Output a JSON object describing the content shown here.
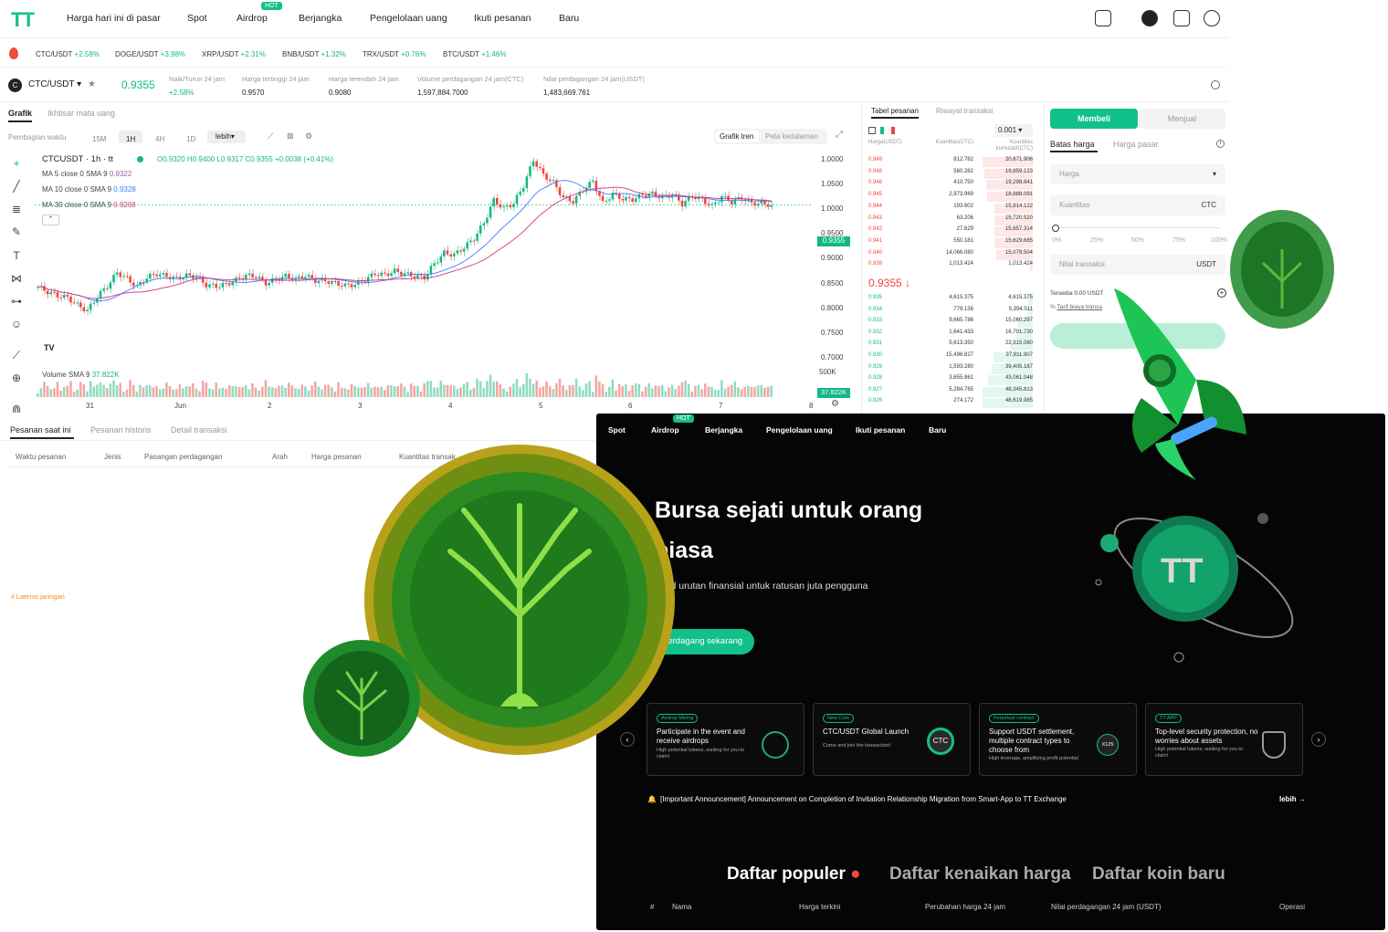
{
  "nav": {
    "logo": "TT",
    "items": [
      "Harga hari ini di pasar",
      "Spot",
      "Airdrop",
      "Berjangka",
      "Pengelolaan uang",
      "Ikuti pesanan",
      "Baru"
    ],
    "hot_badge": "HOT"
  },
  "ticker": [
    {
      "pair": "CTC/USDT",
      "change": "+2.58%"
    },
    {
      "pair": "DOGE/USDT",
      "change": "+3.98%"
    },
    {
      "pair": "XRP/USDT",
      "change": "+2.31%"
    },
    {
      "pair": "BNB/USDT",
      "change": "+1.32%"
    },
    {
      "pair": "TRX/USDT",
      "change": "+0.76%"
    },
    {
      "pair": "BTC/USDT",
      "change": "+1.46%"
    }
  ],
  "pair": {
    "name": "CTC/USDT",
    "price": "0.9355",
    "stats": [
      {
        "label": "Naik/Turun 24 jam",
        "value": "+2.58%"
      },
      {
        "label": "Harga tertinggi 24 jam",
        "value": "0.9570"
      },
      {
        "label": "Harga terendah 24 jam",
        "value": "0.9080"
      },
      {
        "label": "Volume perdagangan 24 jam(CTC)",
        "value": "1,597,884.7000"
      },
      {
        "label": "Nilai perdagangan 24 jam(USDT)",
        "value": "1,483,669.761"
      }
    ]
  },
  "chart_tabs": [
    "Grafik",
    "Ikhtisar mata uang"
  ],
  "timeframes": {
    "label": "Pembagian waktu",
    "items": [
      "15M",
      "1H",
      "4H",
      "1D"
    ],
    "active": "1H",
    "more": "lebih",
    "view_trend": "Grafik tren",
    "view_depth": "Peta kedalaman"
  },
  "chart_legend": {
    "symbol": "CTCUSDT · 1h · tt",
    "ohlc": "O0.9320 H0.9400 L0.9317 C0.9355 +0.0038 (+0.41%)",
    "ma5": "MA 5 close 0 SMA 9",
    "ma5_val": "0.9322",
    "ma10": "MA 10 close 0 SMA 9",
    "ma10_val": "0.9328",
    "ma30": "MA 30 close 0 SMA 9",
    "ma30_val": "0.9268",
    "volume": "Volume SMA 9",
    "volume_val": "37.822K",
    "last_price": "0.9355",
    "last_volume": "37.822K",
    "vol_axis": "500K"
  },
  "chart_data": {
    "type": "candlestick",
    "ylim": [
      0.695,
      1.0
    ],
    "y_ticks": [
      "1.0000",
      "1.0500",
      "1.0000",
      "0.9500",
      "0.9000",
      "0.8500",
      "0.8000",
      "0.7500",
      "0.7000"
    ],
    "x_ticks": [
      "31",
      "Jun",
      "2",
      "3",
      "4",
      "5",
      "6",
      "7",
      "8"
    ],
    "close": [
      0.805,
      0.797,
      0.791,
      0.788,
      0.776,
      0.767,
      0.79,
      0.806,
      0.828,
      0.818,
      0.805,
      0.82,
      0.826,
      0.822,
      0.818,
      0.823,
      0.821,
      0.808,
      0.806,
      0.809,
      0.816,
      0.823,
      0.822,
      0.811,
      0.817,
      0.822,
      0.817,
      0.823,
      0.815,
      0.815,
      0.811,
      0.807,
      0.809,
      0.816,
      0.826,
      0.824,
      0.83,
      0.826,
      0.822,
      0.82,
      0.842,
      0.859,
      0.856,
      0.868,
      0.882,
      0.907,
      0.943,
      0.93,
      0.938,
      0.966,
      1.007,
      0.983,
      0.971,
      0.947,
      0.941,
      0.96,
      0.973,
      0.938,
      0.953,
      0.945,
      0.944,
      0.951,
      0.953,
      0.947,
      0.952,
      0.937,
      0.95,
      0.944,
      0.933,
      0.949,
      0.94,
      0.947,
      0.938,
      0.938,
      0.935
    ]
  },
  "orderbook": {
    "tabs": [
      "Tabel pesanan",
      "Riwayat transaksi"
    ],
    "precision": "0.001",
    "col_price": "Harga(USDT)",
    "col_qty": "Kuantitas(CTC)",
    "col_cum": "Kuantitas kumulatif(CTC)",
    "asks": [
      [
        "0.949",
        "812.782",
        "20,671.906"
      ],
      [
        "0.948",
        "560.282",
        "19,859.123"
      ],
      [
        "0.946",
        "410.750",
        "19,298.841"
      ],
      [
        "0.945",
        "2,973.969",
        "18,888.091"
      ],
      [
        "0.944",
        "193.602",
        "15,914.122"
      ],
      [
        "0.943",
        "63.206",
        "15,720.520"
      ],
      [
        "0.942",
        "27.629",
        "15,657.314"
      ],
      [
        "0.941",
        "550.181",
        "15,629.685"
      ],
      [
        "0.940",
        "14,066.080",
        "15,079.504"
      ],
      [
        "0.939",
        "1,013.424",
        "1,013.424"
      ]
    ],
    "mid_price": "0.9355",
    "bids": [
      [
        "0.935",
        "4,615.375",
        "4,615.375"
      ],
      [
        "0.934",
        "779.136",
        "5,394.511"
      ],
      [
        "0.933",
        "9,665.786",
        "15,060.297"
      ],
      [
        "0.932",
        "1,641.433",
        "16,701.730"
      ],
      [
        "0.931",
        "5,613.350",
        "22,315.080"
      ],
      [
        "0.930",
        "15,496.827",
        "37,811.907"
      ],
      [
        "0.929",
        "1,593.280",
        "39,405.187"
      ],
      [
        "0.928",
        "3,655.861",
        "43,061.048"
      ],
      [
        "0.927",
        "5,284.765",
        "48,345.813"
      ],
      [
        "0.926",
        "274.172",
        "48,619.985"
      ]
    ]
  },
  "trade": {
    "buy": "Membeli",
    "sell": "Menjual",
    "limit": "Batas harga",
    "market": "Harga pasar",
    "price_ph": "Harga",
    "qty_ph": "Kuantitas",
    "qty_unit": "CTC",
    "pcts": [
      "0%",
      "25%",
      "50%",
      "75%",
      "100%"
    ],
    "value_ph": "Nilai transaksi",
    "value_unit": "USDT",
    "available": "Tersedia 0.00 USDT",
    "fee": "Tarif biaya transa"
  },
  "orders": {
    "tabs": [
      "Pesanan saat ini",
      "Pesanan historis",
      "Detail transaksi"
    ],
    "cols": [
      "Waktu pesanan",
      "Jenis",
      "Pasangan perdagangan",
      "Arah",
      "Harga pesanan",
      "Kuantitas transak"
    ],
    "latency": "Latensi jaringan"
  },
  "promo": {
    "nav": [
      "Spot",
      "Airdrop",
      "Berjangka",
      "Pengelolaan uang",
      "Ikuti pesanan",
      "Baru"
    ],
    "hot": "HOT",
    "headline1": "Bursa sejati untuk orang",
    "headline2": "biasa",
    "sub": "Build urutan finansial untuk ratusan juta pengguna",
    "cta": "Berdagang sekarang",
    "cards": [
      {
        "tag": "Airdrop Mining",
        "title": "Participate in the event and receive airdrops",
        "sub": "High potential tokens, waiting for you to claim!"
      },
      {
        "tag": "New Coin",
        "title": "CTC/USDT Global Launch",
        "sub": "Come and join the transaction!"
      },
      {
        "tag": "Perpetual contract",
        "title": "Support USDT settlement, multiple contract types to choose from",
        "sub": "High leverage, amplifying profit potential"
      },
      {
        "tag": "TT APP",
        "title": "Top-level security protection, no worries about assets",
        "sub": "High potential tokens, waiting for you to claim!"
      }
    ],
    "card2_coin": "CTC",
    "card3_badge": "X125",
    "tt_coin": "TT",
    "announcement": "[Important Announcement] Announcement on Completion of Invitation Relationship Migration from Smart-App to TT Exchange",
    "more": "lebih",
    "lists": [
      "Daftar populer",
      "Daftar kenaikan harga",
      "Daftar koin baru"
    ],
    "table_cols": [
      "#",
      "Nama",
      "Harga terkini",
      "Perubahan harga 24 jam",
      "Nilai perdagangan 24 jam (USDT)",
      "Operasi"
    ]
  },
  "colors": {
    "accent": "#12c08a",
    "up": "#12b886",
    "down": "#f0443c"
  }
}
